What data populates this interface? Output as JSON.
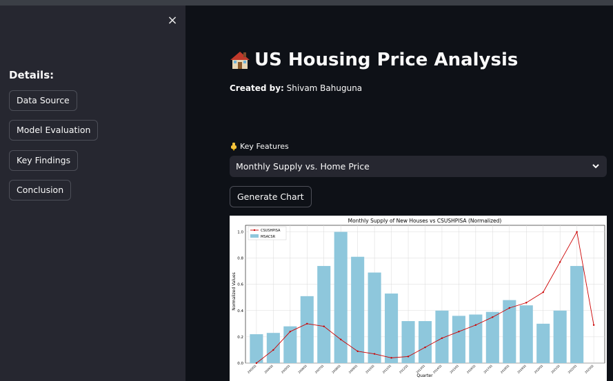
{
  "sidebar": {
    "close_label": "×",
    "heading": "Details:",
    "buttons": [
      {
        "label": "Data Source"
      },
      {
        "label": "Model Evaluation"
      },
      {
        "label": "Key Findings"
      },
      {
        "label": "Conclusion"
      }
    ]
  },
  "main": {
    "title": "US Housing Price Analysis",
    "title_icon": "house-icon",
    "created_label": "Created by:",
    "created_name": "Shivam Bahuguna",
    "features_label": "Key Features",
    "features_icon": "pointing-down-icon",
    "select_value": "Monthly Supply vs. Home Price",
    "generate_label": "Generate Chart"
  },
  "colors": {
    "app_bg": "#0e1117",
    "sidebar_bg": "#262730",
    "bar_color": "#8ec7dc",
    "line_color": "#cc0000"
  },
  "chart_data": {
    "type": "bar",
    "title": "Monthly Supply of New Houses vs CSUSHPISA (Normalized)",
    "xlabel": "Quarter",
    "ylabel": "Normalized Values",
    "ylim": [
      0,
      1.05
    ],
    "yticks": [
      "0.0",
      "0.2",
      "0.4",
      "0.6",
      "0.8",
      "1.0"
    ],
    "grid": true,
    "legend_position": "top-left",
    "categories": [
      "2003Q1",
      "2004Q1",
      "2005Q1",
      "2006Q1",
      "2007Q1",
      "2008Q1",
      "2009Q1",
      "2010Q1",
      "2011Q1",
      "2012Q1",
      "2013Q1",
      "2014Q1",
      "2015Q1",
      "2016Q1",
      "2017Q1",
      "2018Q1",
      "2019Q1",
      "2020Q1",
      "2021Q1",
      "2022Q1",
      "2023Q1"
    ],
    "series": [
      {
        "name": "MSACSR",
        "type": "bar",
        "values": [
          0.22,
          0.23,
          0.28,
          0.51,
          0.74,
          1.0,
          0.81,
          0.69,
          0.53,
          0.32,
          0.32,
          0.4,
          0.36,
          0.37,
          0.39,
          0.48,
          0.44,
          0.3,
          0.4,
          0.74,
          null
        ]
      },
      {
        "name": "CSUSHPISA",
        "type": "line",
        "values": [
          0.0,
          0.1,
          0.24,
          0.3,
          0.28,
          0.18,
          0.09,
          0.07,
          0.04,
          0.05,
          0.12,
          0.19,
          0.24,
          0.29,
          0.35,
          0.42,
          0.46,
          0.54,
          0.77,
          1.0,
          0.29
        ]
      }
    ]
  }
}
